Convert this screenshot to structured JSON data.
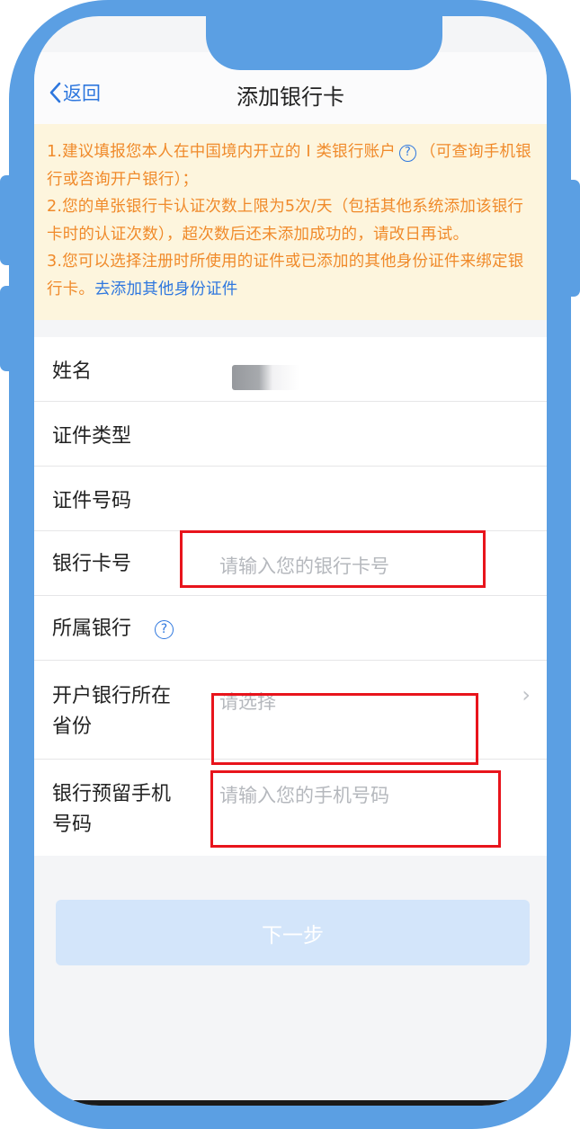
{
  "nav": {
    "back_label": "返回",
    "title": "添加银行卡"
  },
  "notice": {
    "line1_a": "1.建议填报您本人在中国境内开立的 I 类银行账户",
    "line1_help": "?",
    "line1_b": "（可查询手机银行或咨询开户银行）；",
    "line2": "2.您的单张银行卡认证次数上限为5次/天（包括其他系统添加该银行卡时的认证次数），超次数后还未添加成功的，请改日再试。",
    "line3": "3.您可以选择注册时所使用的证件或已添加的其他身份证件来绑定银行卡。",
    "line3_link": "去添加其他身份证件"
  },
  "form": {
    "name_label": "姓名",
    "id_type_label": "证件类型",
    "id_number_label": "证件号码",
    "card_number_label": "银行卡号",
    "card_number_placeholder": "请输入您的银行卡号",
    "bank_label": "所属银行",
    "bank_help": "?",
    "province_label_1": "开户银行所在",
    "province_label_2": "省份",
    "province_placeholder": "请选择",
    "chevron": "›",
    "phone_label_1": "银行预留手机",
    "phone_label_2": "号码",
    "phone_placeholder": "请输入您的手机号码"
  },
  "next_button": "下一步",
  "colors": {
    "frame": "#5b9fe3",
    "accent_blue": "#2e77de",
    "notice_text": "#f08a2a",
    "notice_bg": "#fdf5dd",
    "highlight_red": "#e8141c",
    "button_disabled": "#d3e5fa"
  }
}
